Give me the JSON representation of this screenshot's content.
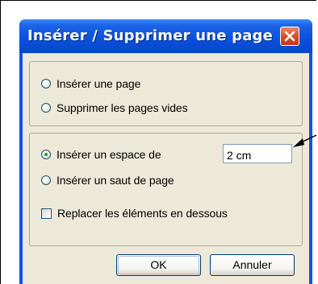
{
  "dialog": {
    "title": "Insérer / Supprimer une page",
    "close_icon": "close-x-icon"
  },
  "group1": {
    "options": [
      {
        "label": "Insérer une page",
        "checked": false
      },
      {
        "label": "Supprimer les pages vides",
        "checked": false
      }
    ]
  },
  "group2": {
    "options": [
      {
        "label": "Insérer un espace de",
        "checked": true
      },
      {
        "label": "Insérer un saut de page",
        "checked": false
      }
    ],
    "space_value": "2 cm",
    "checkbox": {
      "label": "Replacer les éléments en dessous",
      "checked": false
    }
  },
  "buttons": {
    "ok": "OK",
    "cancel": "Annuler"
  },
  "annotation": {
    "arrow_icon": "arrow-left-icon"
  }
}
